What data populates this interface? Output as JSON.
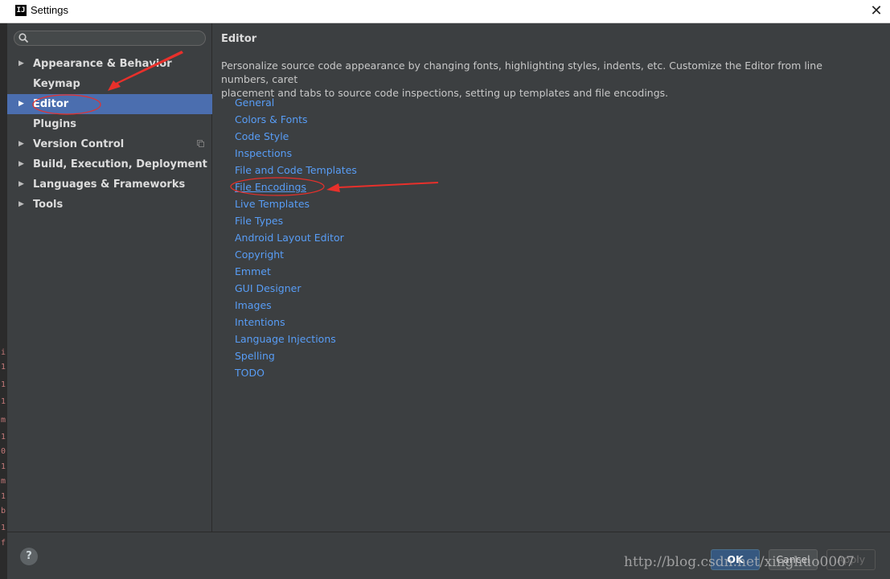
{
  "window": {
    "title": "Settings",
    "app_icon": "intellij-idea-icon",
    "close_symbol": "✕"
  },
  "background_strip": [
    "i",
    "1",
    "1",
    "1",
    "m",
    "1",
    "0",
    "1",
    "m",
    "1",
    "b",
    "1",
    "f"
  ],
  "search": {
    "placeholder": "",
    "value": ""
  },
  "sidebar": {
    "items": [
      {
        "label": "Appearance & Behavior",
        "expandable": true,
        "selected": false
      },
      {
        "label": "Keymap",
        "expandable": false,
        "selected": false
      },
      {
        "label": "Editor",
        "expandable": true,
        "selected": true
      },
      {
        "label": "Plugins",
        "expandable": false,
        "selected": false
      },
      {
        "label": "Version Control",
        "expandable": true,
        "selected": false,
        "has_copy_icon": true
      },
      {
        "label": "Build, Execution, Deployment",
        "expandable": true,
        "selected": false
      },
      {
        "label": "Languages & Frameworks",
        "expandable": true,
        "selected": false
      },
      {
        "label": "Tools",
        "expandable": true,
        "selected": false
      }
    ]
  },
  "main": {
    "title": "Editor",
    "description_line1": "Personalize source code appearance by changing fonts, highlighting styles, indents, etc. Customize the Editor from line numbers, caret",
    "description_line2": "placement and tabs to source code inspections, setting up templates and file encodings.",
    "links": [
      "General",
      "Colors & Fonts",
      "Code Style",
      "Inspections",
      "File and Code Templates",
      "File Encodings",
      "Live Templates",
      "File Types",
      "Android Layout Editor",
      "Copyright",
      "Emmet",
      "GUI Designer",
      "Images",
      "Intentions",
      "Language Injections",
      "Spelling",
      "TODO"
    ],
    "highlighted_link": "File Encodings"
  },
  "footer": {
    "help_symbol": "?",
    "ok_label": "OK",
    "cancel_label": "Cancel",
    "apply_label": "Apply"
  },
  "watermark": "http://blog.csdn.net/xinghuo0007",
  "colors": {
    "selection": "#4b6eaf",
    "link": "#589df6",
    "annotation_red": "#e8302b"
  }
}
